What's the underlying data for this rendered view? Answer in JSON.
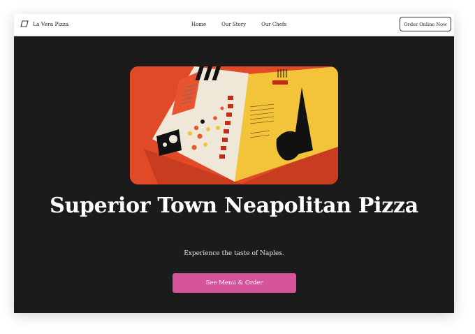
{
  "brand": {
    "name": "La Vera Pizza",
    "icon": "parallelogram-logo-icon"
  },
  "nav": {
    "links": [
      "Home",
      "Our Story",
      "Our Chefs"
    ],
    "order_button": "Order Online Now"
  },
  "hero": {
    "image": "pizza-menu-brochure-photo",
    "title": "Superior Town Neapolitan Pizza",
    "subtitle": "Experience the taste of Naples.",
    "cta": "See Menu & Order"
  },
  "colors": {
    "background": "#1c1b1b",
    "cta": "#d6549a",
    "nav": "#ffffff"
  }
}
